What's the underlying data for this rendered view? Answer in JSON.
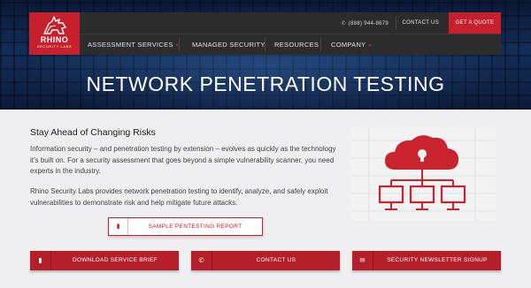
{
  "brand": {
    "name": "RHINO",
    "subtitle": "SECURITY LABS",
    "accent": "#c5202b"
  },
  "utility": {
    "phone": "(888) 944-8679",
    "contact": "CONTACT US",
    "quote": "GET A QUOTE"
  },
  "menu": [
    {
      "label": "ASSESSMENT SERVICES",
      "has_dropdown": true
    },
    {
      "label": "MANAGED SECURITY",
      "has_dropdown": false
    },
    {
      "label": "RESOURCES",
      "has_dropdown": false
    },
    {
      "label": "COMPANY",
      "has_dropdown": true
    }
  ],
  "hero": {
    "title": "NETWORK PENETRATION TESTING"
  },
  "content": {
    "heading": "Stay Ahead of Changing Risks",
    "paragraph1": "Information security – and penetration testing by extension – evolves as quickly as the technology it’s built on. For a security assessment that goes beyond a simple vulnerability scanner, you need experts in the industry.",
    "paragraph2": "Rhino Security Labs provides network penetration testing to identify, analyze, and safely exploit vulnerabilities to demonstrate risk and help mitigate future attacks.",
    "illustration_icon": "cloud-lock-network-icon"
  },
  "buttons": {
    "sample_report": "SAMPLE PENTESTING REPORT",
    "download_brief": "DOWNLOAD SERVICE BRIEF",
    "contact_us": "CONTACT US",
    "newsletter": "SECURITY NEWSLETTER SIGNUP"
  }
}
